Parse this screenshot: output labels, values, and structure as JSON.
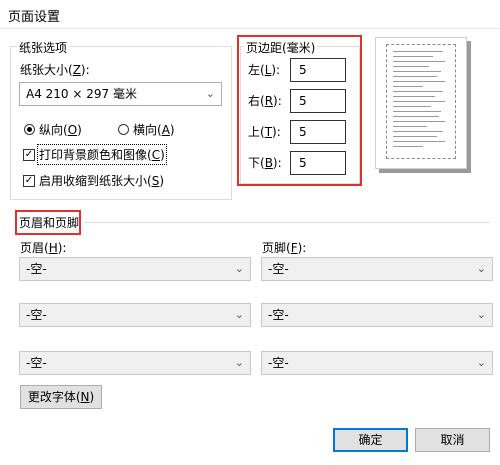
{
  "window": {
    "title": "页面设置"
  },
  "paper": {
    "group_label": "纸张选项",
    "size_label": "纸张大小(",
    "size_key": "Z",
    "size_label_end": "):",
    "size_value": "A4 210 × 297 毫米",
    "orientation": {
      "portrait_label": "纵向(",
      "portrait_key": "O",
      "portrait_end": ")",
      "landscape_label": "横向(",
      "landscape_key": "A",
      "landscape_end": ")",
      "selected": "portrait"
    },
    "print_bg_label": "打印背景颜色和图像(",
    "print_bg_key": "C",
    "print_bg_end": ")",
    "print_bg_checked": true,
    "shrink_label": "启用收缩到纸张大小(",
    "shrink_key": "S",
    "shrink_end": ")",
    "shrink_checked": true
  },
  "margins": {
    "group_label": "页边距(毫米)",
    "left_label": "左(",
    "left_key": "L",
    "left_end": "):",
    "left_value": "5",
    "right_label": "右(",
    "right_key": "R",
    "right_end": "):",
    "right_value": "5",
    "top_label": "上(",
    "top_key": "T",
    "top_end": "):",
    "top_value": "5",
    "bottom_label": "下(",
    "bottom_key": "B",
    "bottom_end": "):",
    "bottom_value": "5"
  },
  "header_footer": {
    "group_label": "页眉和页脚",
    "header_label": "页眉(",
    "header_key": "H",
    "header_end": "):",
    "footer_label": "页脚(",
    "footer_key": "F",
    "footer_end": "):",
    "header_values": [
      "-空-",
      "-空-",
      "-空-"
    ],
    "footer_values": [
      "-空-",
      "-空-",
      "-空-"
    ],
    "change_font_label": "更改字体(",
    "change_font_key": "N",
    "change_font_end": ")"
  },
  "buttons": {
    "ok": "确定",
    "cancel": "取消"
  },
  "colors": {
    "highlight": "#e03030",
    "focus": "#0078d7"
  }
}
